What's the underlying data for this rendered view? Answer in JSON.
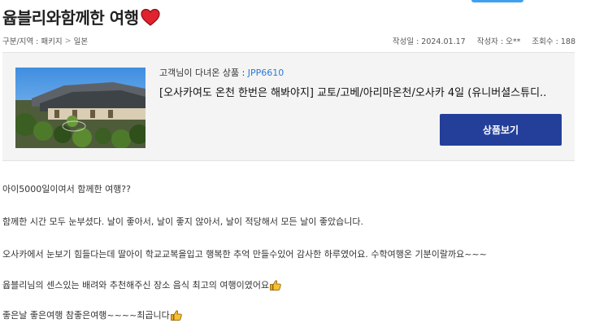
{
  "title": "윱블리와함께한 여행",
  "icons": {
    "title_heart": "heart-icon",
    "thumbs": "thumbs-up-icon"
  },
  "breadcrumb": {
    "category_label": "구분/지역 : 패키지",
    "separator": ">",
    "region": "일본"
  },
  "meta": {
    "date": "작성일 : 2024.01.17",
    "author": "작성자 : 오**",
    "views": "조회수 : 188"
  },
  "product": {
    "label_prefix": "고객님이 다녀온 상품 : ",
    "code": "JPP6610",
    "name": "[오사카여도 온천 한번은 해봐야지] 교토/고베/아리마온천/오사카 4일 (유니버셜스튜디..",
    "button_label": "상품보기"
  },
  "content": {
    "p1": "아이5000일이여서 함께한 여행??",
    "p2": "함께한 시간 모두 눈부셨다. 날이 좋아서, 날이 좋지 않아서, 날이 적당해서 모든 날이 좋았습니다.",
    "p3": "오사카에서 눈보기 힘들다는데 딸아이 학교교복을입고  행복한 추억 만들수있어 감사한 하루였어요. 수학여행온 기분이랄까요~~~",
    "p4": "윱블리님의 센스있는 배려와 추천해주신 장소 음식 최고의 여행이였어요",
    "p5": "좋은날 좋은여행 참좋은여행~~~~최곱니다"
  },
  "colors": {
    "accent_button": "#243f9a",
    "code_link": "#2a7ad6",
    "heart": "#e0232e"
  }
}
